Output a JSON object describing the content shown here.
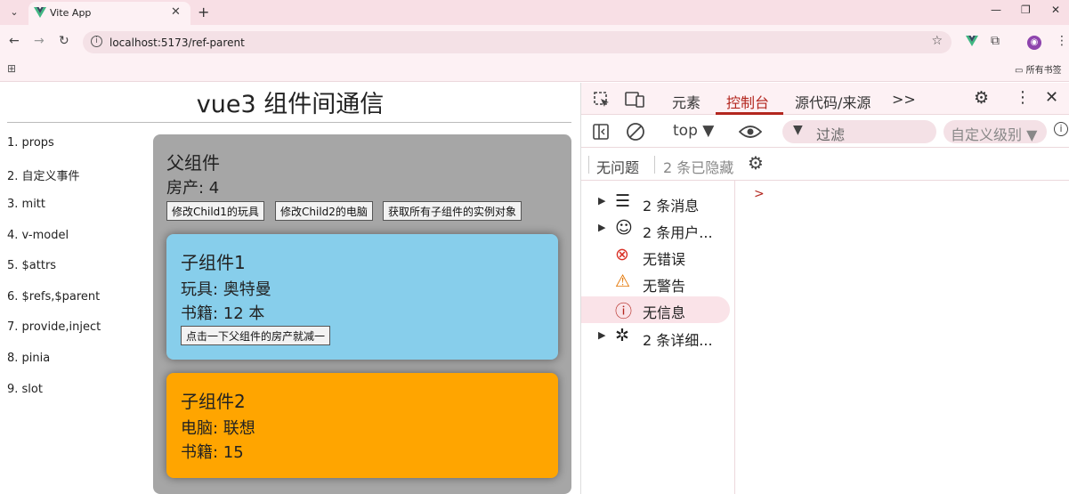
{
  "browser": {
    "tab_title": "Vite App",
    "tab_close": "✕",
    "new_tab": "+",
    "url": "localhost:5173/ref-parent",
    "bookmark_folder": "所有书签",
    "minimize": "—",
    "maximize": "❐",
    "close": "✕",
    "back": "←",
    "forward": "→",
    "reload": "↻"
  },
  "page": {
    "title": "vue3 组件间通信",
    "nav": [
      "1. props",
      "2. 自定义事件",
      "3. mitt",
      "4. v-model",
      "5. $attrs",
      "6. $refs,$parent",
      "7. provide,inject",
      "8. pinia",
      "9. slot"
    ],
    "parent": {
      "heading": "父组件",
      "house": "房产: 4",
      "buttons": [
        "修改Child1的玩具",
        "修改Child2的电脑",
        "获取所有子组件的实例对象"
      ]
    },
    "child1": {
      "heading": "子组件1",
      "toy": "玩具: 奥特曼",
      "books": "书籍: 12 本",
      "button": "点击一下父组件的房产就减一"
    },
    "child2": {
      "heading": "子组件2",
      "computer": "电脑: 联想",
      "books": "书籍: 15"
    },
    "colors": {
      "parent_bg": "#a6a6a6",
      "child1_bg": "#87ceeb",
      "child2_bg": "#ffa500"
    }
  },
  "devtools": {
    "tabs": [
      "元素",
      "控制台",
      "源代码/来源"
    ],
    "active_tab": "控制台",
    "more": ">>",
    "context": "top ▼",
    "filter_placeholder": "过滤",
    "level": "自定义级别 ▼",
    "issues": "无问题",
    "hidden": "2 条已隐藏",
    "sidebar": [
      "2 条消息",
      "2 条用户...",
      "无错误",
      "无警告",
      "无信息",
      "2 条详细..."
    ],
    "prompt": ">"
  }
}
